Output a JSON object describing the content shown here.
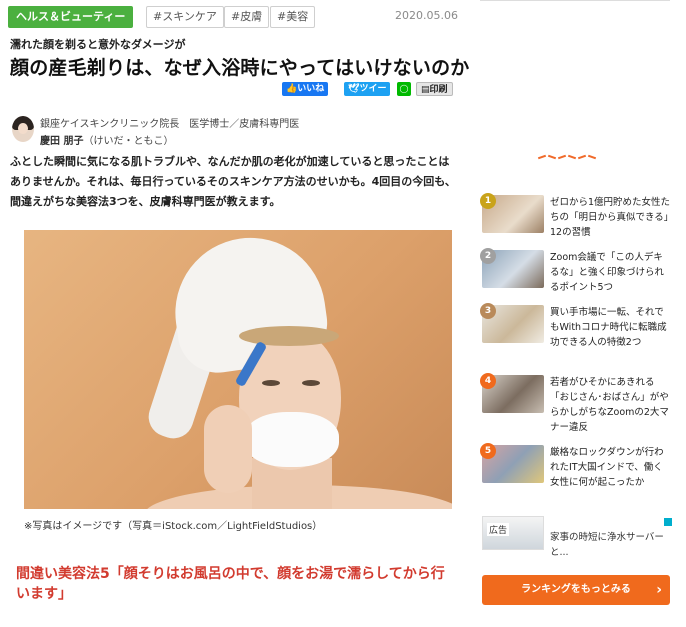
{
  "article": {
    "category": "ヘルス＆ビューティー",
    "tags": [
      "#スキンケア",
      "#皮膚",
      "#美容"
    ],
    "date": "2020.05.06",
    "kicker": "濡れた顔を剃ると意外なダメージが",
    "title": "顔の産毛剃りは、なぜ入浴時にやってはいけないのか",
    "share": {
      "like": "いいね",
      "tweet": "ツイー",
      "line": "LINE",
      "print": "印刷"
    },
    "author": {
      "affiliation": "銀座ケイスキンクリニック院長　医学博士／皮膚科専門医",
      "name": "慶田 朋子",
      "reading": "（けいだ・ともこ）"
    },
    "lead": "ふとした瞬間に気になる肌トラブルや、なんだか肌の老化が加速していると思ったことはありませんか。それは、毎日行っているそのスキンケア方法のせいかも。4回目の今回も、間違えがちな美容法3つを、皮膚科専門医が教えます。",
    "photo_caption": "※写真はイメージです（写真＝iStock.com／LightFieldStudios）",
    "subhead": "間違い美容法5「顔そりはお風呂の中で、顔をお湯で濡らしてから行います」"
  },
  "sidebar": {
    "ranking": [
      {
        "rank": "1",
        "title": "ゼロから1億円貯めた女性たちの「明日から真似できる」12の習慣",
        "badge_color": "#c9a31a"
      },
      {
        "rank": "2",
        "title": "Zoom会議で「この人デキるな」と強く印象づけられるポイント5つ",
        "badge_color": "#a0a0a0"
      },
      {
        "rank": "3",
        "title": "買い手市場に一転、それでもWithコロナ時代に転職成功できる人の特徴2つ",
        "badge_color": "#b98a5a"
      },
      {
        "rank": "4",
        "title": "若者がひそかにあきれる「おじさん･おばさん」がやらかしがちなZoomの2大マナー違反",
        "badge_color": "#f06a1d"
      },
      {
        "rank": "5",
        "title": "厳格なロックダウンが行われたIT大国インドで、働く女性に何が起こったか",
        "badge_color": "#f06a1d"
      }
    ],
    "ad": {
      "label": "広告",
      "title": "家事の時短に浄水サーバーと..."
    },
    "more_button": "ランキングをもっとみる",
    "more_chevron": "›"
  },
  "colors": {
    "accent_green": "#4bb03f",
    "accent_orange": "#f06a1d",
    "headline_red": "#d23b2f"
  }
}
